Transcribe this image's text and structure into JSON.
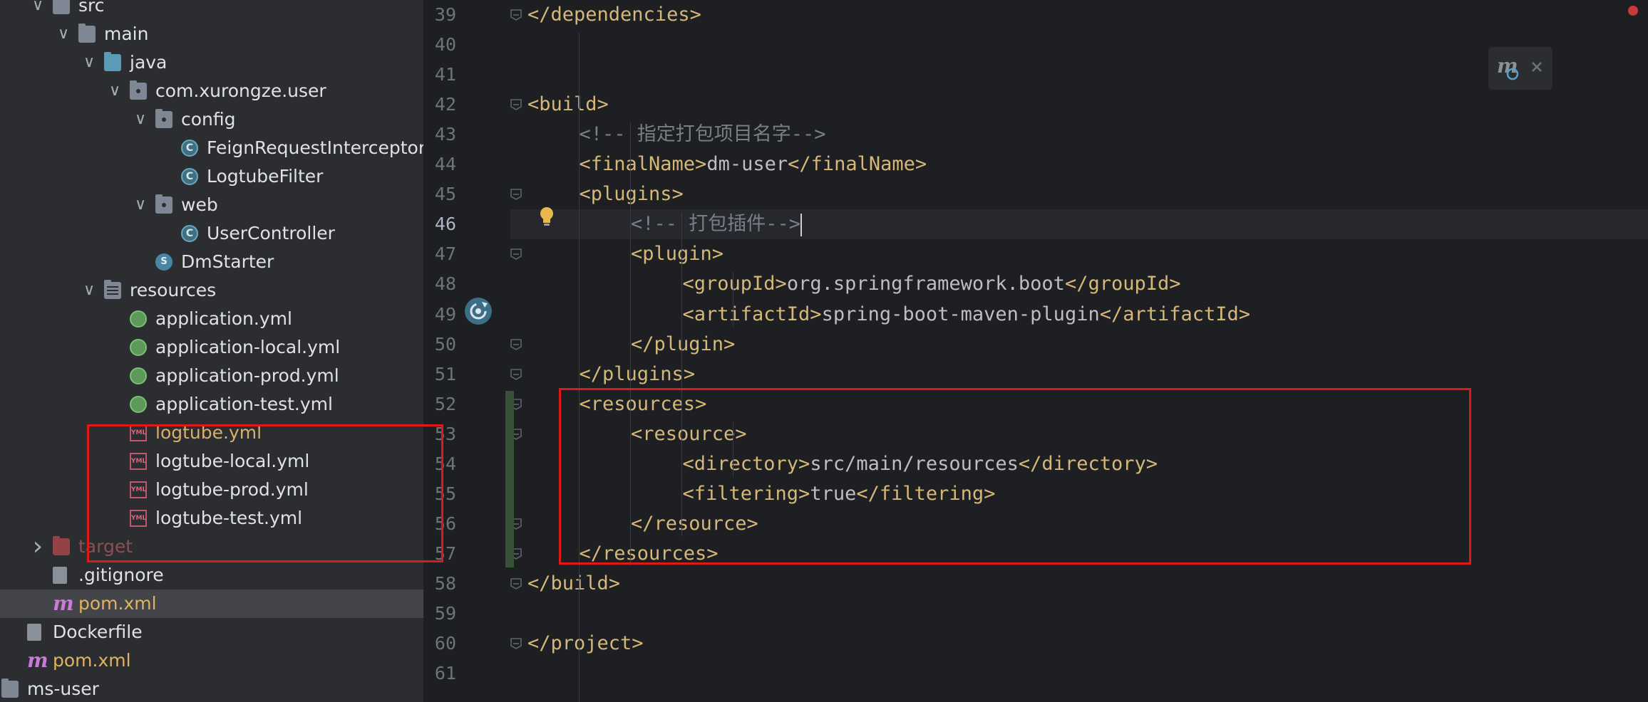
{
  "project_tree": {
    "items": [
      {
        "label": "src",
        "icon": "source-folder-icon",
        "chevron": "down",
        "depth": 0
      },
      {
        "label": "main",
        "icon": "folder-icon",
        "chevron": "down",
        "depth": 1
      },
      {
        "label": "java",
        "icon": "source-root-folder-icon",
        "chevron": "down",
        "depth": 2
      },
      {
        "label": "com.xurongze.user",
        "icon": "package-icon",
        "chevron": "down",
        "depth": 3
      },
      {
        "label": "config",
        "icon": "package-icon",
        "chevron": "down",
        "depth": 4
      },
      {
        "label": "FeignRequestInterceptor",
        "icon": "java-class-icon",
        "chevron": "none",
        "depth": 5
      },
      {
        "label": "LogtubeFilter",
        "icon": "java-class-icon",
        "chevron": "none",
        "depth": 5
      },
      {
        "label": "web",
        "icon": "package-icon",
        "chevron": "down",
        "depth": 4
      },
      {
        "label": "UserController",
        "icon": "java-class-icon",
        "chevron": "none",
        "depth": 5
      },
      {
        "label": "DmStarter",
        "icon": "spring-boot-class-icon",
        "chevron": "none",
        "depth": 4
      },
      {
        "label": "resources",
        "icon": "resources-folder-icon",
        "chevron": "down",
        "depth": 2
      },
      {
        "label": "application.yml",
        "icon": "spring-config-icon",
        "chevron": "none",
        "depth": 3
      },
      {
        "label": "application-local.yml",
        "icon": "spring-config-icon",
        "chevron": "none",
        "depth": 3
      },
      {
        "label": "application-prod.yml",
        "icon": "spring-config-icon",
        "chevron": "none",
        "depth": 3
      },
      {
        "label": "application-test.yml",
        "icon": "spring-config-icon",
        "chevron": "none",
        "depth": 3
      },
      {
        "label": "logtube.yml",
        "icon": "yml-file-icon",
        "chevron": "none",
        "depth": 3,
        "color": "yellow"
      },
      {
        "label": "logtube-local.yml",
        "icon": "yml-file-icon",
        "chevron": "none",
        "depth": 3
      },
      {
        "label": "logtube-prod.yml",
        "icon": "yml-file-icon",
        "chevron": "none",
        "depth": 3
      },
      {
        "label": "logtube-test.yml",
        "icon": "yml-file-icon",
        "chevron": "none",
        "depth": 3
      },
      {
        "label": "target",
        "icon": "excluded-folder-icon",
        "chevron": "right",
        "depth": 0,
        "color": "dim"
      },
      {
        "label": ".gitignore",
        "icon": "gitignore-file-icon",
        "chevron": "none",
        "depth": 0
      },
      {
        "label": "pom.xml",
        "icon": "maven-pom-icon",
        "chevron": "none",
        "depth": 0,
        "color": "orange",
        "selected": true
      },
      {
        "label": "Dockerfile",
        "icon": "file-icon",
        "chevron": "none",
        "depth": -1
      },
      {
        "label": "pom.xml",
        "icon": "maven-pom-icon",
        "chevron": "none",
        "depth": -1,
        "color": "orange"
      },
      {
        "label": "ms-user",
        "icon": "module-folder-icon",
        "chevron": "none",
        "depth": -2
      }
    ]
  },
  "editor": {
    "current_line": 46,
    "lines": [
      {
        "num": "39",
        "indent": 1,
        "parts": [
          [
            "tag",
            "</dependencies>"
          ]
        ]
      },
      {
        "num": "40",
        "indent": 0,
        "parts": []
      },
      {
        "num": "41",
        "indent": 0,
        "parts": []
      },
      {
        "num": "42",
        "indent": 1,
        "parts": [
          [
            "tag",
            "<build>"
          ]
        ]
      },
      {
        "num": "43",
        "indent": 2,
        "parts": [
          [
            "cmt",
            "<!-- 指定打包项目名字-->"
          ]
        ]
      },
      {
        "num": "44",
        "indent": 2,
        "parts": [
          [
            "tag",
            "<finalName>"
          ],
          [
            "txt",
            "dm-user"
          ],
          [
            "tag",
            "</finalName>"
          ]
        ]
      },
      {
        "num": "45",
        "indent": 2,
        "parts": [
          [
            "tag",
            "<plugins>"
          ]
        ]
      },
      {
        "num": "46",
        "indent": 3,
        "parts": [
          [
            "cmt",
            "<!-- 打包插件-->"
          ]
        ]
      },
      {
        "num": "47",
        "indent": 3,
        "parts": [
          [
            "tag",
            "<plugin>"
          ]
        ]
      },
      {
        "num": "48",
        "indent": 4,
        "parts": [
          [
            "tag",
            "<groupId>"
          ],
          [
            "txt",
            "org.springframework.boot"
          ],
          [
            "tag",
            "</groupId>"
          ]
        ]
      },
      {
        "num": "49",
        "indent": 4,
        "parts": [
          [
            "tag",
            "<artifactId>"
          ],
          [
            "txt",
            "spring-boot-maven-plugin"
          ],
          [
            "tag",
            "</artifactId>"
          ]
        ]
      },
      {
        "num": "50",
        "indent": 3,
        "parts": [
          [
            "tag",
            "</plugin>"
          ]
        ]
      },
      {
        "num": "51",
        "indent": 2,
        "parts": [
          [
            "tag",
            "</plugins>"
          ]
        ]
      },
      {
        "num": "52",
        "indent": 2,
        "parts": [
          [
            "tag",
            "<resources>"
          ]
        ]
      },
      {
        "num": "53",
        "indent": 3,
        "parts": [
          [
            "tag",
            "<resource>"
          ]
        ]
      },
      {
        "num": "54",
        "indent": 4,
        "parts": [
          [
            "tag",
            "<directory>"
          ],
          [
            "txt",
            "src/main/resources"
          ],
          [
            "tag",
            "</directory>"
          ]
        ]
      },
      {
        "num": "55",
        "indent": 4,
        "parts": [
          [
            "tag",
            "<filtering>"
          ],
          [
            "txt",
            "true"
          ],
          [
            "tag",
            "</filtering>"
          ]
        ]
      },
      {
        "num": "56",
        "indent": 3,
        "parts": [
          [
            "tag",
            "</resource>"
          ]
        ]
      },
      {
        "num": "57",
        "indent": 2,
        "parts": [
          [
            "tag",
            "</resources>"
          ]
        ]
      },
      {
        "num": "58",
        "indent": 1,
        "parts": [
          [
            "tag",
            "</build>"
          ]
        ]
      },
      {
        "num": "59",
        "indent": 0,
        "parts": []
      },
      {
        "num": "60",
        "indent": 0,
        "parts": [
          [
            "tag",
            "</project>"
          ]
        ]
      },
      {
        "num": "61",
        "indent": 0,
        "parts": []
      }
    ],
    "fold_lines": [
      "39",
      "42",
      "45",
      "47",
      "50",
      "51",
      "52",
      "53",
      "56",
      "57",
      "58",
      "60"
    ]
  },
  "colors": {
    "tag": "#d5b778",
    "comment": "#7a7e85",
    "text": "#bcbec4",
    "highlight_box": "#e01818"
  }
}
